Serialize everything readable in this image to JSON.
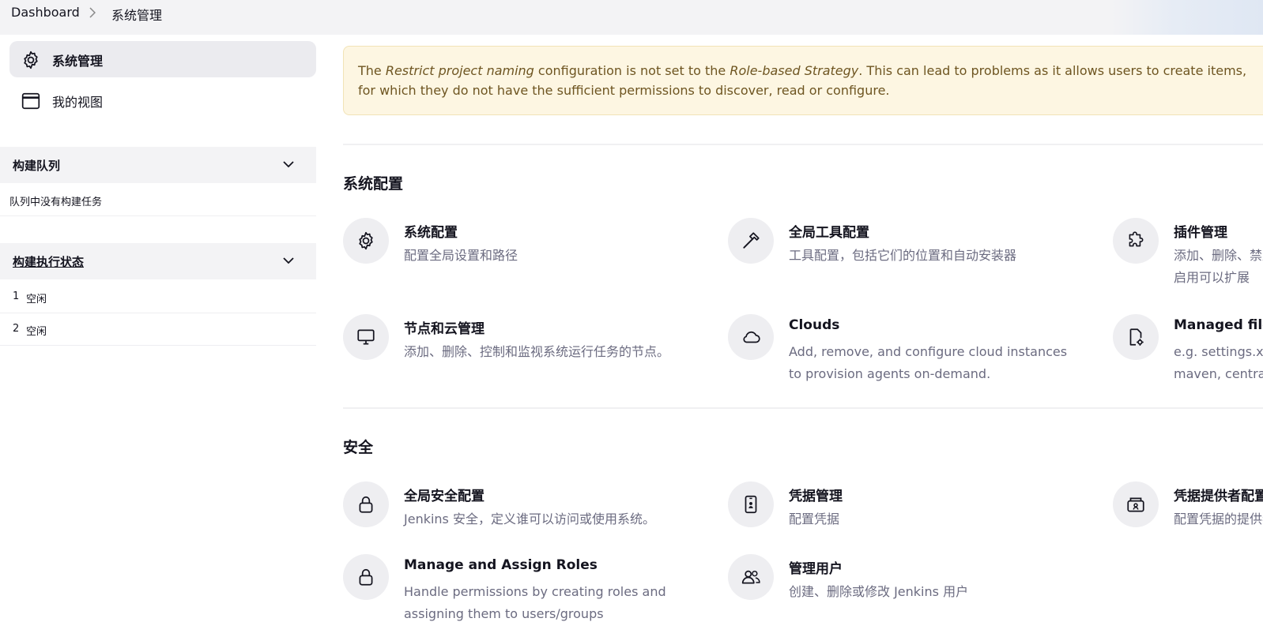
{
  "breadcrumb": {
    "home": "Dashboard",
    "current": "系统管理"
  },
  "sidebar": {
    "items": [
      {
        "label": "系统管理",
        "icon": "gear-icon"
      },
      {
        "label": "我的视图",
        "icon": "window-icon"
      }
    ],
    "build_queue": {
      "title": "构建队列",
      "empty": "队列中没有构建任务"
    },
    "executors": {
      "title": "构建执行状态",
      "rows": [
        {
          "num": "1",
          "status": "空闲"
        },
        {
          "num": "2",
          "status": "空闲"
        }
      ]
    }
  },
  "alert": {
    "p1": "The ",
    "em1": "Restrict project naming",
    "p2": " configuration is not set to the ",
    "em2": "Role-based Strategy",
    "p3": ". This can lead to problems as it allows users to create items, for which they do not have the sufficient permissions to discover, read or configure."
  },
  "sections": {
    "system": {
      "title": "系统配置",
      "tiles": [
        {
          "title": "系统配置",
          "desc": "配置全局设置和路径",
          "icon": "gear-icon"
        },
        {
          "title": "全局工具配置",
          "desc": "工具配置，包括它们的位置和自动安装器",
          "icon": "hammer-icon"
        },
        {
          "title": "插件管理",
          "desc": "添加、删除、禁用或启用可以扩展Jenkins功能的插件。",
          "icon": "puzzle-icon"
        },
        {
          "title": "节点和云管理",
          "desc": "添加、删除、控制和监视系统运行任务的节点。",
          "icon": "monitor-icon"
        },
        {
          "title": "Clouds",
          "desc": "Add, remove, and configure cloud instances to provision agents on-demand.",
          "icon": "cloud-icon"
        },
        {
          "title": "Managed files",
          "desc": "e.g. settings.xml for maven, central managed scripts, custom files, ...",
          "icon": "file-gear-icon"
        }
      ]
    },
    "security": {
      "title": "安全",
      "tiles": [
        {
          "title": "全局安全配置",
          "desc": "Jenkins 安全，定义谁可以访问或使用系统。",
          "icon": "lock-icon"
        },
        {
          "title": "凭据管理",
          "desc": "配置凭据",
          "icon": "phone-badge-icon"
        },
        {
          "title": "凭据提供者配置",
          "desc": "配置凭据的提供者和类型",
          "icon": "key-safe-icon"
        },
        {
          "title": "Manage and Assign Roles",
          "desc": "Handle permissions by creating roles and assigning them to users/groups",
          "icon": "lock-icon"
        },
        {
          "title": "管理用户",
          "desc": "创建、删除或修改 Jenkins 用户",
          "icon": "users-icon"
        }
      ]
    }
  },
  "colors": {
    "alert_bg": "#fdf6e2",
    "alert_text": "#6e5521",
    "sidebar_active": "#ebebef",
    "icon_circle": "#eeeef1"
  }
}
